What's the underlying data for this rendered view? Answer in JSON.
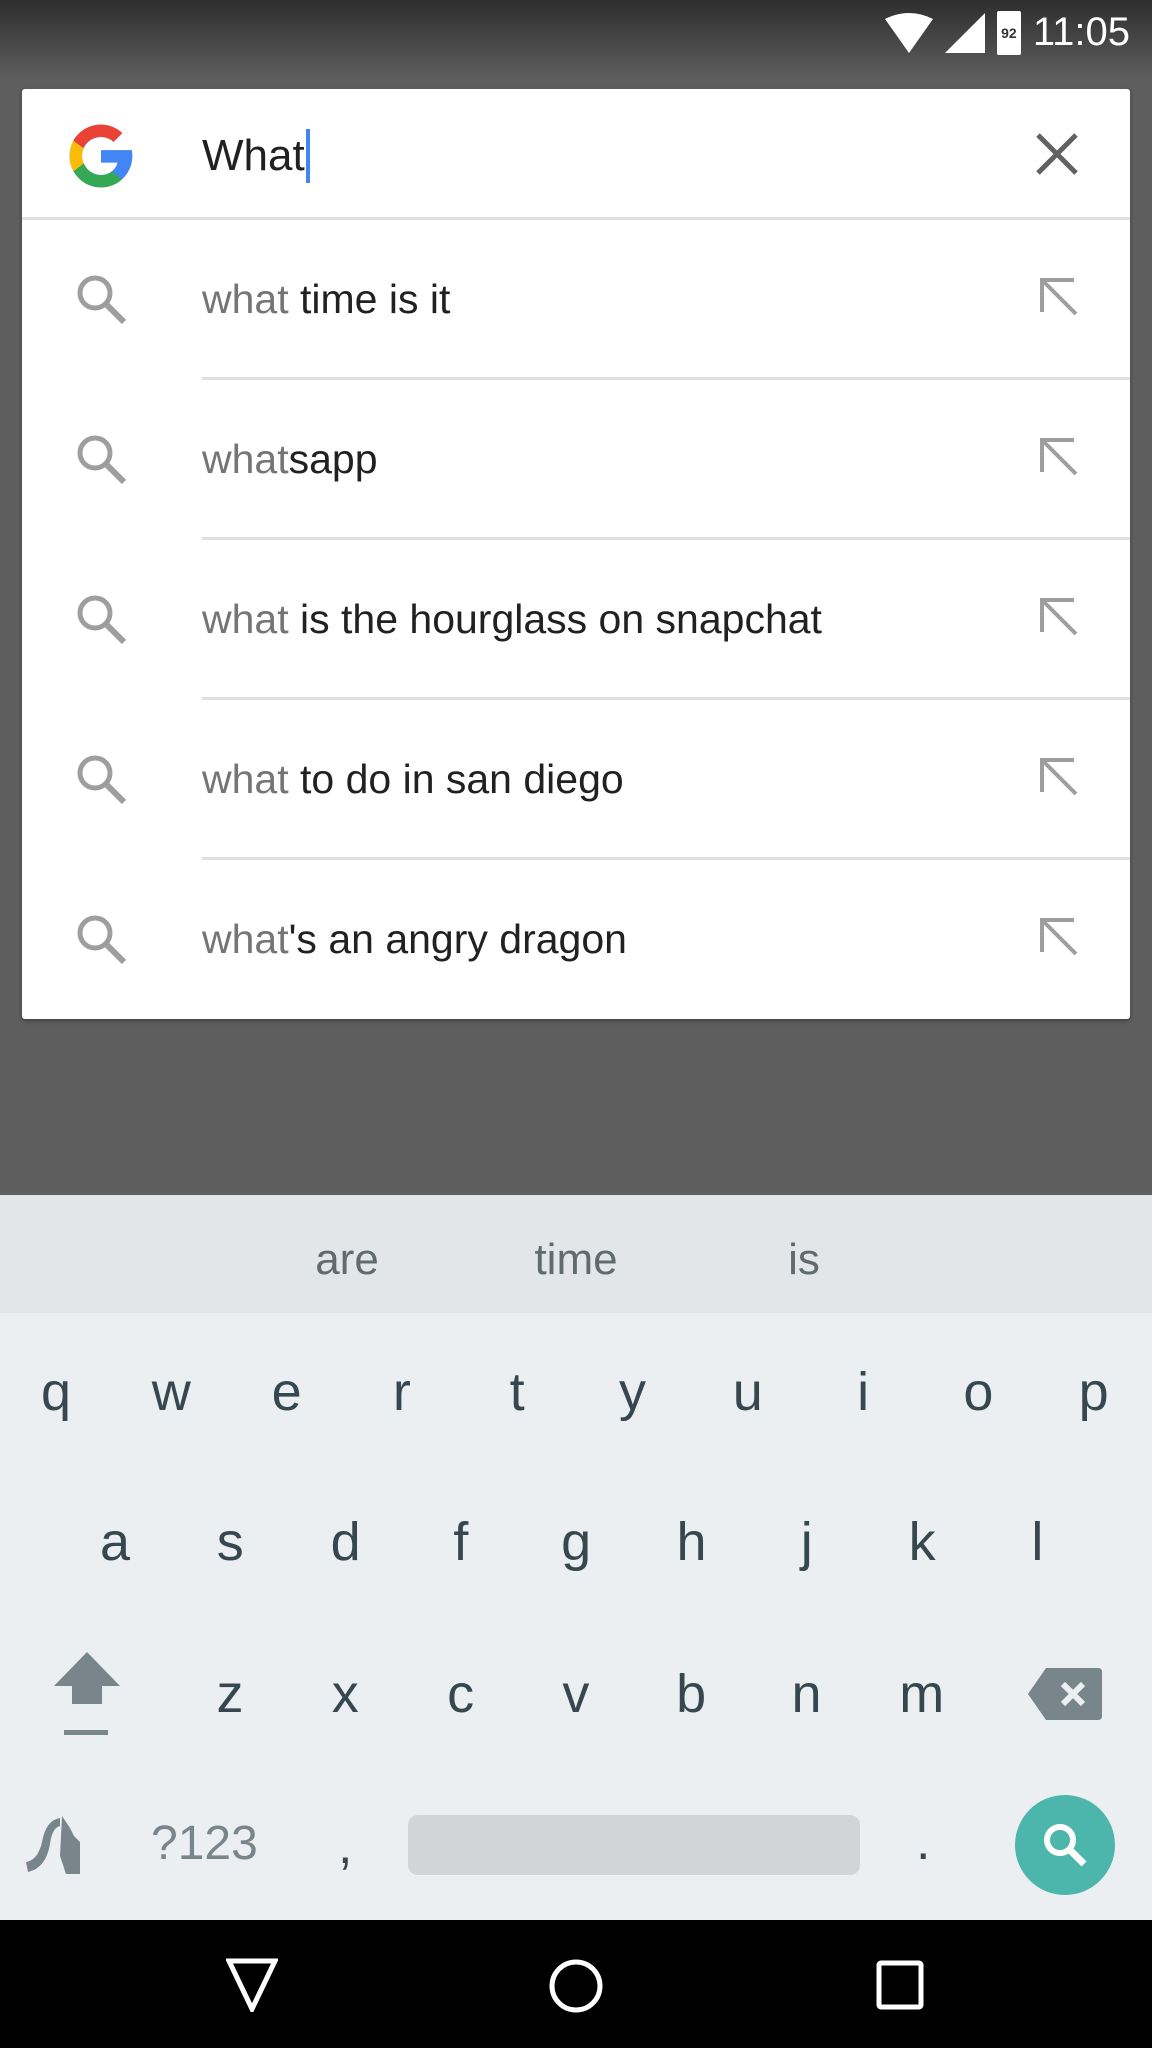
{
  "status_bar": {
    "time": "11:05",
    "battery_level": "92",
    "icons": [
      "wifi-icon",
      "signal-icon",
      "battery-icon"
    ]
  },
  "search": {
    "query": "What",
    "logo": "Google",
    "clear_icon": "close-icon"
  },
  "suggestions": [
    {
      "prefix": "what",
      "rest": " time is it"
    },
    {
      "prefix": "what",
      "rest": "sapp"
    },
    {
      "prefix": "what",
      "rest": " is the hourglass on snapchat"
    },
    {
      "prefix": "what",
      "rest": " to do in san diego"
    },
    {
      "prefix": "what",
      "rest": "'s an angry dragon"
    }
  ],
  "keyboard": {
    "word_suggestions": [
      "are",
      "time",
      "is"
    ],
    "row1": [
      "q",
      "w",
      "e",
      "r",
      "t",
      "y",
      "u",
      "i",
      "o",
      "p"
    ],
    "row2": [
      "a",
      "s",
      "d",
      "f",
      "g",
      "h",
      "j",
      "k",
      "l"
    ],
    "row3": [
      "z",
      "x",
      "c",
      "v",
      "b",
      "n",
      "m"
    ],
    "symbols_label": "?123",
    "comma": ",",
    "period": ".",
    "accent_color": "#4db6ac"
  },
  "nav": {
    "icons": [
      "back-icon",
      "home-icon",
      "recents-icon"
    ]
  }
}
